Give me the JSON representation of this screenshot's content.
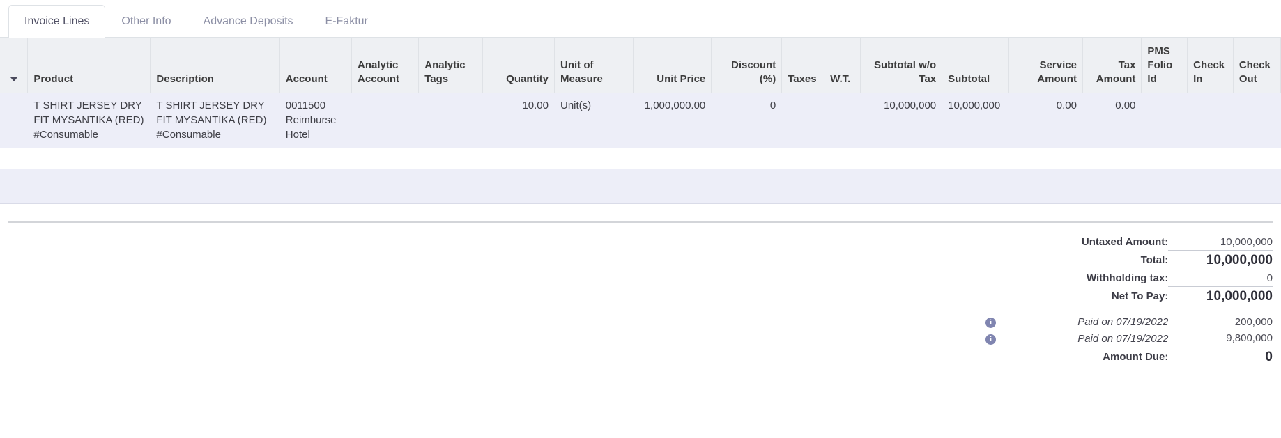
{
  "tabs": [
    {
      "label": "Invoice Lines",
      "active": true
    },
    {
      "label": "Other Info",
      "active": false
    },
    {
      "label": "Advance Deposits",
      "active": false
    },
    {
      "label": "E-Faktur",
      "active": false
    }
  ],
  "table": {
    "handle_icon": "chevron-down-icon",
    "columns": [
      {
        "label": "Product",
        "align": "left"
      },
      {
        "label": "Description",
        "align": "left"
      },
      {
        "label": "Account",
        "align": "left"
      },
      {
        "label": "Analytic Account",
        "align": "left"
      },
      {
        "label": "Analytic Tags",
        "align": "left"
      },
      {
        "label": "Quantity",
        "align": "right"
      },
      {
        "label": "Unit of Measure",
        "align": "left"
      },
      {
        "label": "Unit Price",
        "align": "right"
      },
      {
        "label": "Discount (%)",
        "align": "right"
      },
      {
        "label": "Taxes",
        "align": "left"
      },
      {
        "label": "W.T.",
        "align": "left"
      },
      {
        "label": "Subtotal w/o Tax",
        "align": "right"
      },
      {
        "label": "Subtotal",
        "align": "left"
      },
      {
        "label": "Service Amount",
        "align": "right"
      },
      {
        "label": "Tax Amount",
        "align": "right"
      },
      {
        "label": "PMS Folio Id",
        "align": "left"
      },
      {
        "label": "Check In",
        "align": "left"
      },
      {
        "label": "Check Out",
        "align": "left"
      }
    ],
    "rows": [
      {
        "product": "T SHIRT JERSEY DRY FIT MYSANTIKA (RED) #Consumable",
        "description": "T SHIRT JERSEY DRY FIT MYSANTIKA (RED) #Consumable",
        "account": "0011500 Reimburse Hotel",
        "analytic_account": "",
        "analytic_tags": "",
        "quantity": "10.00",
        "uom": "Unit(s)",
        "unit_price": "1,000,000.00",
        "discount": "0",
        "taxes": "",
        "wt": "",
        "subtotal_wo_tax": "10,000,000",
        "subtotal": "10,000,000",
        "service_amount": "0.00",
        "tax_amount": "0.00",
        "pms_folio_id": "",
        "check_in": "",
        "check_out": ""
      }
    ]
  },
  "totals": {
    "untaxed_amount_label": "Untaxed Amount:",
    "untaxed_amount_value": "10,000,000",
    "total_label": "Total:",
    "total_value": "10,000,000",
    "withholding_tax_label": "Withholding tax:",
    "withholding_tax_value": "0",
    "net_to_pay_label": "Net To Pay:",
    "net_to_pay_value": "10,000,000",
    "payments": [
      {
        "icon": "info-icon",
        "label": "Paid on 07/19/2022",
        "value": "200,000"
      },
      {
        "icon": "info-icon",
        "label": "Paid on 07/19/2022",
        "value": "9,800,000"
      }
    ],
    "amount_due_label": "Amount Due:",
    "amount_due_value": "0"
  },
  "colors": {
    "row_highlight": "#edeef8",
    "header_bg": "#eef0f3",
    "tab_active_text": "#4e4e63",
    "tab_inactive_text": "#8c8fa5",
    "info_icon": "#8085b0"
  }
}
